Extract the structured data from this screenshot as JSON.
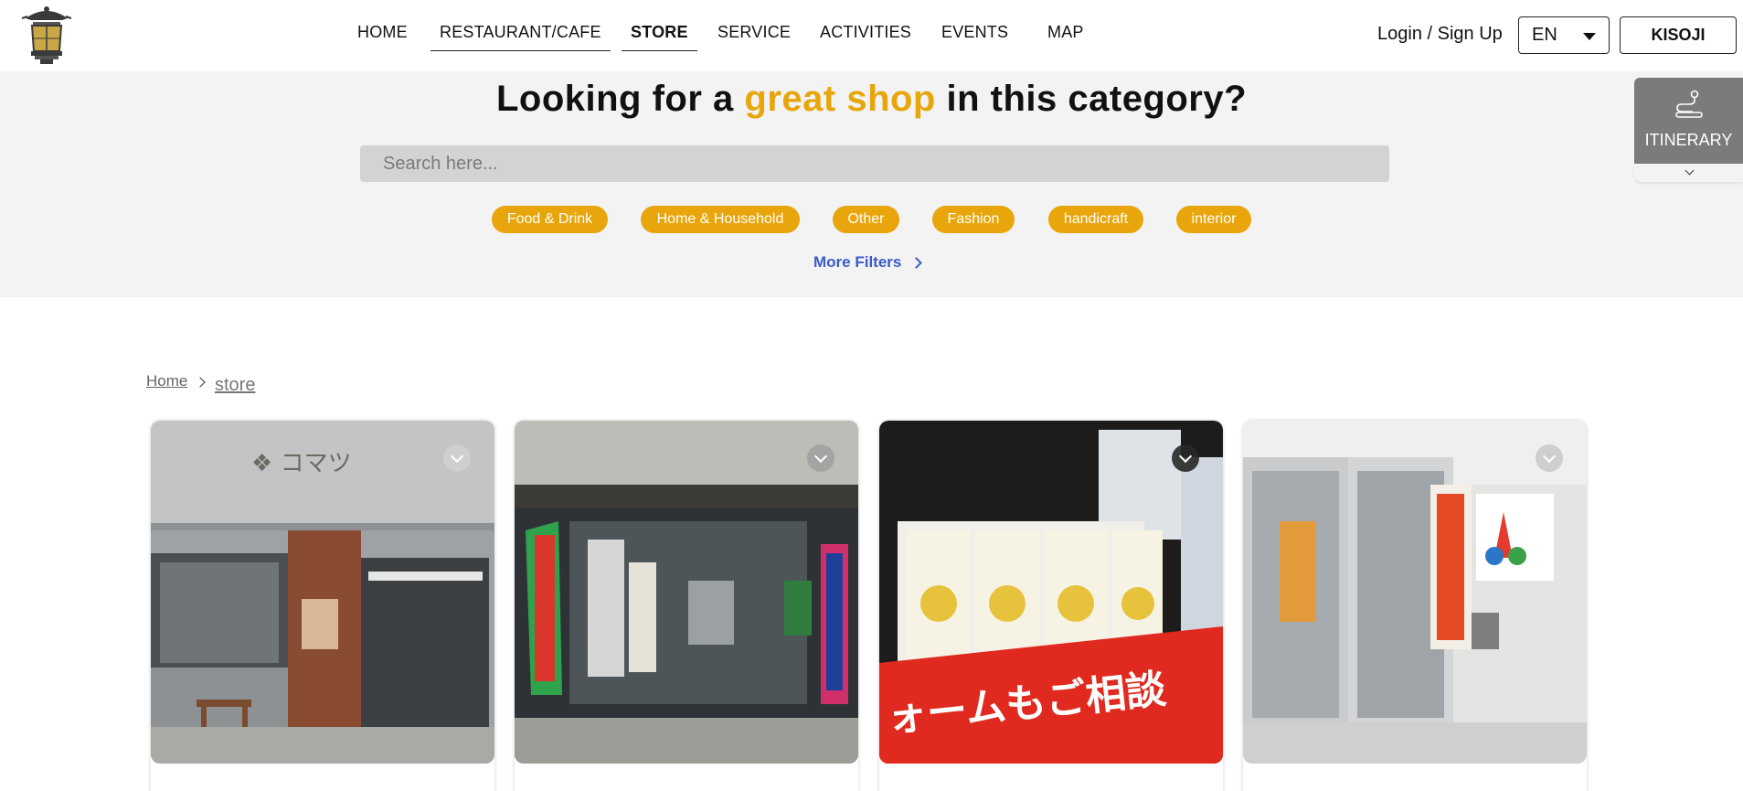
{
  "header": {
    "nav": [
      "HOME",
      "RESTAURANT/CAFE",
      "STORE",
      "SERVICE",
      "ACTIVITIES",
      "EVENTS",
      "MAP"
    ],
    "active_nav": "STORE",
    "login_label": "Login / Sign Up",
    "language": "EN",
    "brand_button": "KISOJI",
    "logo_icon": "lantern-logo"
  },
  "search": {
    "headline_before": "Looking for a ",
    "headline_accent": "great shop",
    "headline_after": " in this category?",
    "placeholder": "Search here...",
    "categories": [
      "Food & Drink",
      "Home & Household",
      "Other",
      "Fashion",
      "handicraft",
      "interior"
    ],
    "more_filters": "More Filters"
  },
  "itinerary": {
    "label": "ITINERARY",
    "icon": "route-icon"
  },
  "breadcrumb": {
    "home": "Home",
    "current": "store"
  },
  "cards": [
    {
      "photo": "storefront-komatsu",
      "fav_icon": "chevron-down-icon"
    },
    {
      "photo": "storefront-banners",
      "fav_icon": "chevron-down-icon"
    },
    {
      "photo": "led-bulbs-display",
      "fav_icon": "chevron-down-icon"
    },
    {
      "photo": "storefront-tokutake",
      "fav_icon": "chevron-down-icon"
    }
  ],
  "colors": {
    "accent": "#e8a60c",
    "link": "#3b5bc7",
    "banner_bg": "#f3f3f3",
    "itinerary_bg": "#7b7b7b"
  }
}
